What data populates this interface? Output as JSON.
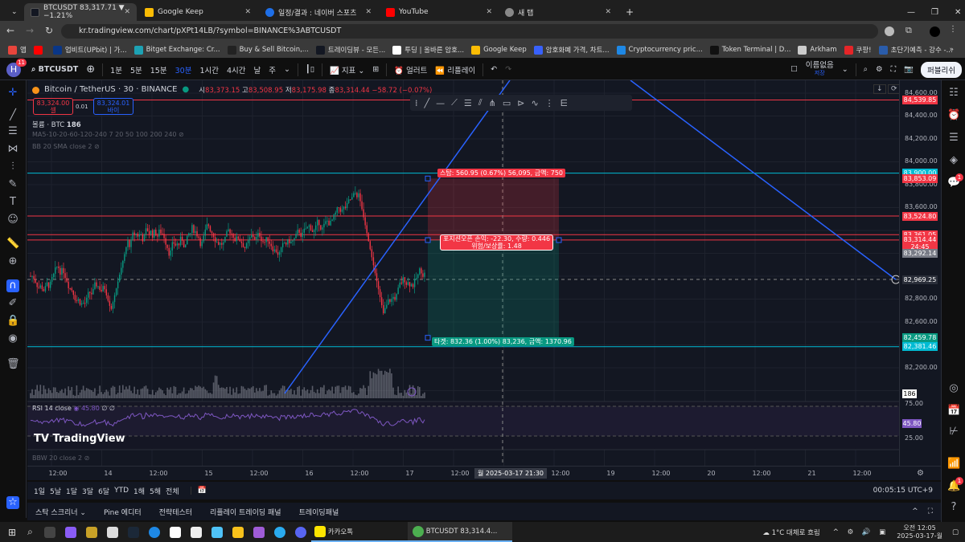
{
  "browser": {
    "tabs": [
      {
        "title": "BTCUSDT 83,317.71 ▼ −1.21%",
        "active": true,
        "color": "#131722"
      },
      {
        "title": "Google Keep",
        "color": "#fbbc04"
      },
      {
        "title": "일정/결과 : 네이버 스포츠",
        "color": "#1e6fe8"
      },
      {
        "title": "YouTube",
        "color": "#ff0000"
      },
      {
        "title": "새 탭",
        "color": "#888888"
      }
    ],
    "new_tab": "+",
    "url": "kr.tradingview.com/chart/pXPt14LB/?symbol=BINANCE%3ABTCUSDT",
    "bookmarks": [
      {
        "label": "앱",
        "color": "#e8453c"
      },
      {
        "label": "",
        "color": "#ff0000"
      },
      {
        "label": "업비트(UPbit) | 가...",
        "color": "#093687"
      },
      {
        "label": "Bitget Exchange: Cr...",
        "color": "#1da2b4"
      },
      {
        "label": "Buy & Sell Bitcoin,...",
        "color": "#222"
      },
      {
        "label": "트레이딩뷰 - 모든...",
        "color": "#131722"
      },
      {
        "label": "투딩 | 올바른 암호...",
        "color": "#ffffff"
      },
      {
        "label": "Google Keep",
        "color": "#fbbc04"
      },
      {
        "label": "암호화폐 가격, 차트...",
        "color": "#3861fb"
      },
      {
        "label": "Cryptocurrency pric...",
        "color": "#1e88e5"
      },
      {
        "label": "Token Terminal | D...",
        "color": "#111"
      },
      {
        "label": "Arkham",
        "color": "#ccc"
      },
      {
        "label": "쿠팡!",
        "color": "#e52528"
      },
      {
        "label": "초단기예측 - 강수 -...",
        "color": "#2a5caa"
      }
    ],
    "bookmarks_more": "»"
  },
  "toolbar": {
    "avatar": "H",
    "avatar_badge": "11",
    "symbol": "BTCUSDT",
    "intervals": [
      "1분",
      "5분",
      "15분",
      "30분",
      "1시간",
      "4시간",
      "날",
      "주"
    ],
    "active_interval": "30분",
    "indicators": "지표",
    "alert": "얼러트",
    "replay": "리플레이",
    "layout_name": "이름없음",
    "layout_saved": "저장",
    "publish": "퍼블리쉬"
  },
  "legend": {
    "title": "Bitcoin / TetherUS · 30 · BINANCE",
    "o_label": "시",
    "o": "83,373.15",
    "h_label": "고",
    "h": "83,508.95",
    "l_label": "저",
    "l": "83,175.98",
    "c_label": "종",
    "c": "83,314.44",
    "change": "−58.72 (−0.07%)",
    "sell_price": "83,324.00",
    "sell_label": "셀",
    "spread": "0.01",
    "buy_price": "83,324.01",
    "buy_label": "바이",
    "volume": "볼륨 · BTC",
    "volume_val": "186",
    "ma": "MA5-10-20-60-120-240 7 20 50 100 200 240",
    "bb": "BB 20 SMA close 2",
    "rsi": "RSI 14 close",
    "rsi_val": "45.80",
    "rsi_extra": "∅ ∅",
    "bbw": "BBW 20 close 2",
    "logo": "TradingView"
  },
  "position": {
    "stop": "스탑: 560.95 (0.67%) 56,095, 금액: 750",
    "pnl": "포지션오픈 손익: -22.30, 수량: 0.446",
    "rr": "위험/보상률: 1.48",
    "target": "타겟: 832.36 (1.00%) 83,236, 금액: 1370.96"
  },
  "price_axis": {
    "ticks": [
      "84,600.00",
      "84,400.00",
      "84,200.00",
      "84,000.00",
      "83,800.00",
      "83,600.00",
      "82,800.00",
      "82,600.00",
      "82,200.00"
    ],
    "tags": [
      {
        "text": "84,539.85",
        "color": "#f23645",
        "price": 84539.85
      },
      {
        "text": "83,900.00",
        "color": "#00bcd4",
        "price": 83900
      },
      {
        "text": "83,853.09",
        "color": "#f23645",
        "price": 83853.09
      },
      {
        "text": "83,524.80",
        "color": "#f23645",
        "price": 83524.8
      },
      {
        "text": "83,361.05",
        "color": "#f23645",
        "price": 83361.05
      },
      {
        "text": "83,314.44",
        "color": "#f23645",
        "price": 83314.44
      },
      {
        "text": "24:45",
        "color": "#f23645",
        "price": 83252
      },
      {
        "text": "83,292.14",
        "color": "#787b86",
        "price": 83200
      },
      {
        "text": "82,969.25",
        "color": "#2a2e39",
        "price": 82969.25
      },
      {
        "text": "82,459.78",
        "color": "#089981",
        "price": 82459.78
      },
      {
        "text": "82,381.46",
        "color": "#00bcd4",
        "price": 82381.46
      }
    ],
    "volume_tag": "186",
    "rsi_ticks": [
      "75.00",
      "25.00"
    ],
    "rsi_tag": "45.80"
  },
  "time_axis": {
    "labels": [
      "12:00",
      "14",
      "12:00",
      "15",
      "12:00",
      "16",
      "12:00",
      "17",
      "12:00",
      "12:00",
      "19",
      "12:00",
      "20",
      "12:00",
      "21",
      "12:00"
    ],
    "crosshair": "월 2025-03-17  21:30"
  },
  "range_bar": {
    "items": [
      "1일",
      "5날",
      "1달",
      "3달",
      "6달",
      "YTD",
      "1해",
      "5해",
      "전체"
    ],
    "clock": "00:05:15 UTC+9"
  },
  "bottom_panel": {
    "tabs": [
      "스탁 스크리너 ⌄",
      "Pine 에디터",
      "전략테스터",
      "리플레이 트레이딩 패널",
      "트레이딩패널"
    ]
  },
  "right_sidebar": {
    "chat_badge": "1",
    "alert_badge": "1"
  },
  "taskbar": {
    "kakao": "카카오톡",
    "chrome": "BTCUSDT 83,314.4...",
    "weather": "1°C  대체로 흐림",
    "time": "오전 12:05",
    "date": "2025-03-17-월"
  }
}
